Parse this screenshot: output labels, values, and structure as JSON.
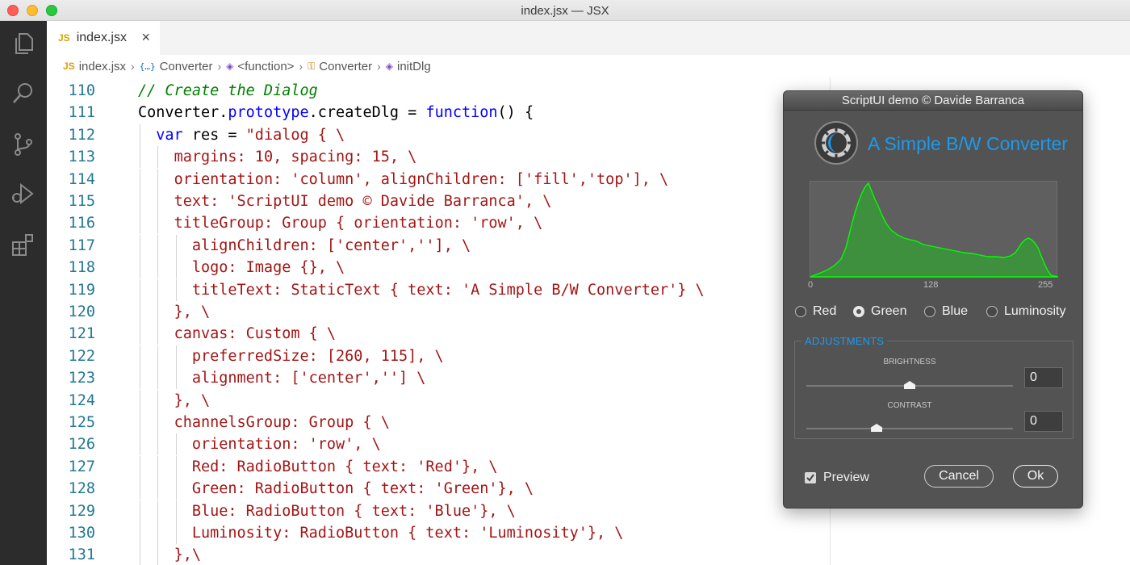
{
  "window": {
    "title": "index.jsx — JSX"
  },
  "activity_bar": {
    "icons": [
      "files-icon",
      "search-icon",
      "source-control-icon",
      "run-debug-icon",
      "extensions-icon"
    ]
  },
  "tabs": [
    {
      "badge": "JS",
      "label": "index.jsx",
      "close": "×"
    }
  ],
  "breadcrumbs": [
    {
      "icon": "JS",
      "label": "index.jsx"
    },
    {
      "icon": "{…}",
      "label": "Converter"
    },
    {
      "icon": "◈",
      "label": "<function>"
    },
    {
      "icon": "⚿",
      "label": "Converter"
    },
    {
      "icon": "◈",
      "label": "initDlg"
    }
  ],
  "editor": {
    "lines": [
      {
        "n": "110",
        "code": "// Create the Dialog"
      },
      {
        "n": "111",
        "code": "Converter.prototype.createDlg = function() {"
      },
      {
        "n": "112",
        "code": "  var res = \"dialog { \\"
      },
      {
        "n": "113",
        "code": "    margins: 10, spacing: 15, \\"
      },
      {
        "n": "114",
        "code": "    orientation: 'column', alignChildren: ['fill','top'], \\"
      },
      {
        "n": "115",
        "code": "    text: 'ScriptUI demo © Davide Barranca', \\"
      },
      {
        "n": "116",
        "code": "    titleGroup: Group { orientation: 'row', \\"
      },
      {
        "n": "117",
        "code": "      alignChildren: ['center',''], \\"
      },
      {
        "n": "118",
        "code": "      logo: Image {}, \\"
      },
      {
        "n": "119",
        "code": "      titleText: StaticText { text: 'A Simple B/W Converter'} \\"
      },
      {
        "n": "120",
        "code": "    }, \\"
      },
      {
        "n": "121",
        "code": "    canvas: Custom { \\"
      },
      {
        "n": "122",
        "code": "      preferredSize: [260, 115], \\"
      },
      {
        "n": "123",
        "code": "      alignment: ['center',''] \\"
      },
      {
        "n": "124",
        "code": "    }, \\"
      },
      {
        "n": "125",
        "code": "    channelsGroup: Group { \\"
      },
      {
        "n": "126",
        "code": "      orientation: 'row', \\"
      },
      {
        "n": "127",
        "code": "      Red: RadioButton { text: 'Red'}, \\"
      },
      {
        "n": "128",
        "code": "      Green: RadioButton { text: 'Green'}, \\"
      },
      {
        "n": "129",
        "code": "      Blue: RadioButton { text: 'Blue'}, \\"
      },
      {
        "n": "130",
        "code": "      Luminosity: RadioButton { text: 'Luminosity'}, \\"
      },
      {
        "n": "131",
        "code": "    },\\"
      }
    ]
  },
  "dialog": {
    "title": "ScriptUI demo © Davide Barranca",
    "app_title": "A Simple B/W Converter",
    "histogram": {
      "ticks": [
        "0",
        "128",
        "255"
      ],
      "fill_color": "#3e8f3e",
      "line_color": "#00ff00"
    },
    "channels": [
      {
        "label": "Red",
        "selected": false
      },
      {
        "label": "Green",
        "selected": true
      },
      {
        "label": "Blue",
        "selected": false
      },
      {
        "label": "Luminosity",
        "selected": false
      }
    ],
    "adjustments": {
      "title": "ADJUSTMENTS",
      "brightness": {
        "label": "BRIGHTNESS",
        "value": "0",
        "position": 0.5
      },
      "contrast": {
        "label": "CONTRAST",
        "value": "0",
        "position": 0.34
      }
    },
    "preview": {
      "label": "Preview",
      "checked": true
    },
    "cancel_label": "Cancel",
    "ok_label": "Ok"
  }
}
